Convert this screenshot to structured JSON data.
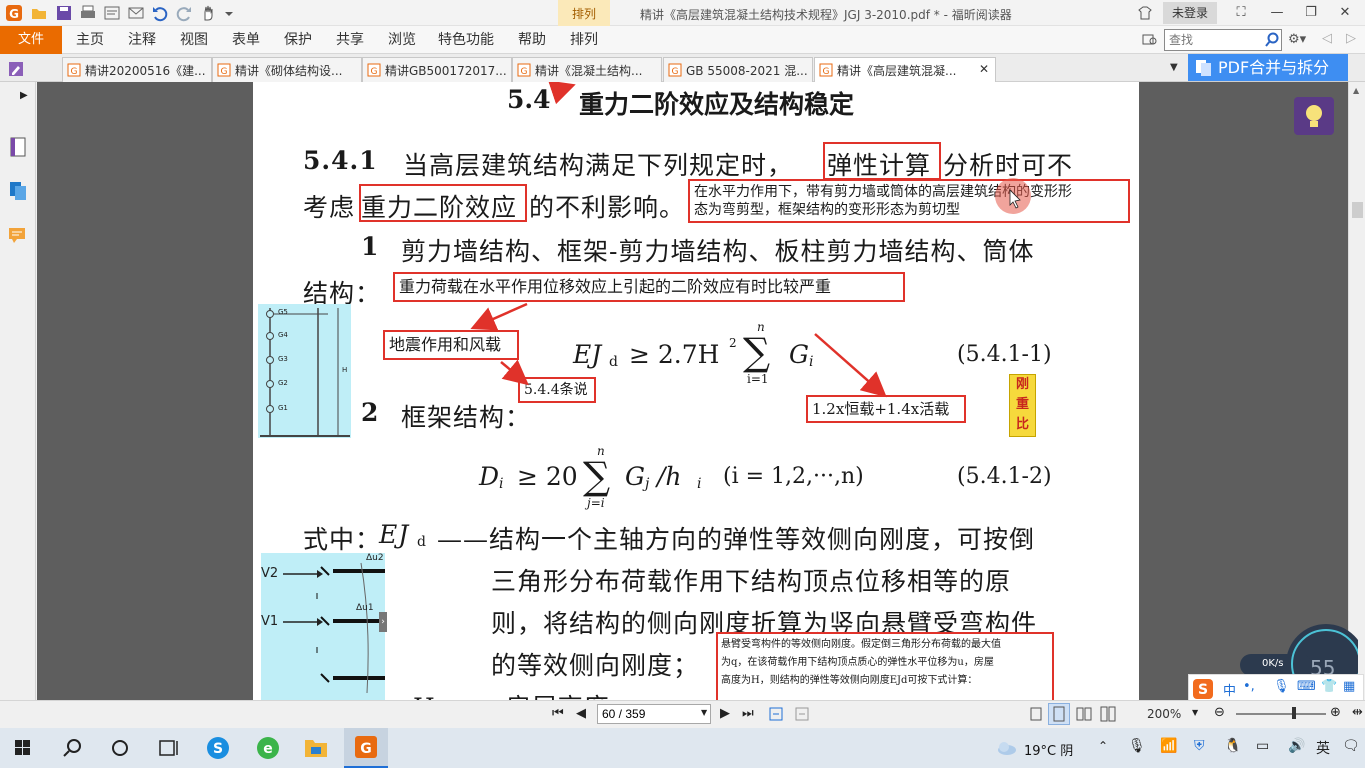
{
  "window": {
    "title": "精讲《高层建筑混凝土结构技术规程》JGJ 3-2010.pdf * - 福昕阅读器",
    "context_tab": "排列",
    "login": "未登录"
  },
  "ribbon": {
    "file": "文件",
    "tabs": [
      "主页",
      "注释",
      "视图",
      "表单",
      "保护",
      "共享",
      "浏览",
      "特色功能",
      "帮助",
      "排列"
    ],
    "search_placeholder": "查找"
  },
  "doc_tabs": [
    "精讲20200516《建...",
    "精讲《砌体结构设...",
    "精讲GB500172017...",
    "精讲《混凝土结构...",
    "GB 55008-2021 混...",
    "精讲《高层建筑混凝..."
  ],
  "pdf_merge": "PDF合并与拆分",
  "document": {
    "section_num": "5.4",
    "section_title": "重力二阶效应及结构稳定",
    "clause_num": "5.4.1",
    "line1_a": "当高层建筑结构满足下列规定时，",
    "line1_box": "弹性计算",
    "line1_b": "分析时可不",
    "line2_a": "考虑",
    "line2_box": "重力二阶效应",
    "line2_b": "的不利影响。",
    "item1_num": "1",
    "item1_text": "剪力墙结构、框架-剪力墙结构、板柱剪力墙结构、筒体",
    "item1_cont": "结构：",
    "item2_num": "2",
    "item2_text": "框架结构：",
    "formula1_lhs": "EJ",
    "formula1_sub": "d",
    "formula1_rel": "≥ 2.7H",
    "formula1_sup": "2",
    "formula1_sum_top": "n",
    "formula1_sum_bot": "i=1",
    "formula1_g": "G",
    "formula1_gsub": "i",
    "formula1_no": "(5.4.1-1)",
    "formula2_lhs": "D",
    "formula2_sub": "i",
    "formula2_rel": "≥ 20",
    "formula2_sum_top": "n",
    "formula2_sum_bot": "j=i",
    "formula2_rest": "G",
    "formula2_gsub": "j",
    "formula2_div": "/h",
    "formula2_hsub": "i",
    "formula2_range": "(i = 1,2,···,n)",
    "formula2_no": "(5.4.1-2)",
    "where_label": "式中：",
    "where_sym": "EJ",
    "where_sub": "d",
    "where_text1": "——结构一个主轴方向的弹性等效侧向刚度，可按倒",
    "where_text2": "三角形分布荷载作用下结构顶点位移相等的原",
    "where_text3": "则，将结构的侧向刚度折算为竖向悬臂受弯构件",
    "where_text4": "的等效侧向刚度；",
    "where_next": "H —— 房屋高度；"
  },
  "annotations": {
    "note_top_line1": "在水平力作用下，带有剪力墙或筒体的高层建筑结构的变形形",
    "note_top_line2": "态为弯剪型，框架结构的变形形态为剪切型",
    "note_gravity": "重力荷载在水平作用位移效应上引起的二阶效应有时比较严重",
    "note_quake": "地震作用和风载",
    "note_clause": "5.4.4条说",
    "note_load": "1.2x恒载+1.4x活载",
    "sticky_line1": "刚",
    "sticky_line2": "重",
    "sticky_line3": "比",
    "note_bottom_line1": "悬臂受弯构件的等效侧向刚度。假定倒三角形分布荷载的最大值",
    "note_bottom_line2": "为q，在该荷载作用下结构顶点质心的弹性水平位移为u，房屋",
    "note_bottom_line3": "高度为H，则结构的弹性等效侧向刚度EJd可按下式计算："
  },
  "figure1": {
    "labels": [
      "G5",
      "G4",
      "G3",
      "G2",
      "G1"
    ],
    "height_label": "H"
  },
  "figure2": {
    "labels": [
      "V2",
      "V1"
    ],
    "top_label": "Δu2",
    "mid_label": "Δu1"
  },
  "status": {
    "page_value": "60 / 359",
    "zoom": "200%"
  },
  "net_widget": {
    "speed": "0K/s",
    "percent": "55"
  },
  "ime": {
    "lang": "中"
  },
  "taskbar": {
    "weather": "19°C 阴"
  },
  "colors": {
    "accent_orange": "#ea6b00",
    "annotation_red": "#e0322a",
    "merge_blue": "#3e8ef2",
    "figure_cyan": "#bfeef7"
  }
}
